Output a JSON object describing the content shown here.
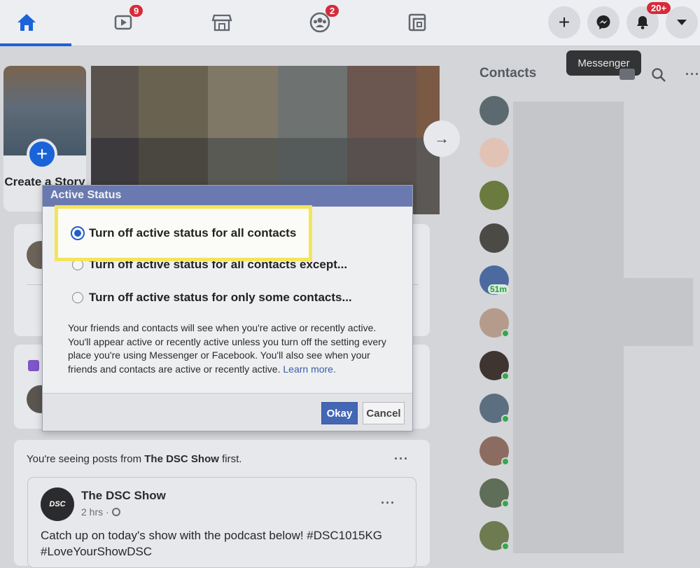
{
  "nav": {
    "watch_badge": "9",
    "groups_badge": "2",
    "notifications_badge": "20+",
    "tooltip": "Messenger"
  },
  "story": {
    "create_label": "Create a Story"
  },
  "contacts": {
    "title": "Contacts",
    "activity_label": "51m"
  },
  "dialog": {
    "title": "Active Status",
    "options": [
      "Turn off active status for all contacts",
      "Turn off active status for all contacts except...",
      "Turn off active status for only some contacts..."
    ],
    "description": "Your friends and contacts will see when you're active or recently active. You'll appear active or recently active unless you turn off the setting every place you're using Messenger or Facebook. You'll also see when your friends and contacts are active or recently active.",
    "learn_more": "Learn more.",
    "okay_label": "Okay",
    "cancel_label": "Cancel"
  },
  "feed": {
    "seeing_prefix": "You're seeing posts from",
    "seeing_page": "The DSC Show",
    "seeing_suffix": "first.",
    "post": {
      "author": "The DSC Show",
      "time": "2 hrs · ",
      "avatar_text": "DSC",
      "body": "Catch up on today's show with the podcast below! #DSC1015KG #LoveYourShowDSC"
    }
  },
  "colors": {
    "accent": "#1b63d8",
    "badge": "#d62b3a",
    "dialog_header": "#6a7ab0",
    "highlight": "#f3e55a",
    "online": "#35a84a"
  }
}
